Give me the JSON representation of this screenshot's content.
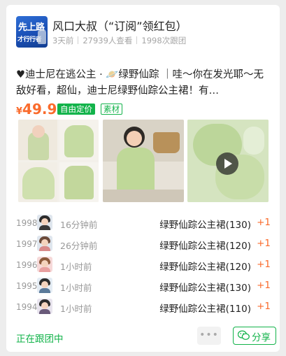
{
  "header": {
    "avatar_line1": "先上路",
    "avatar_line2": "才行行者",
    "name": "风口大叔（“订阅”领红包）",
    "time": "3天前",
    "views": "27939人查看",
    "followers": "1998次跟团"
  },
  "post": {
    "title": "♥迪士尼在逃公主 · 🪐绿野仙踪 ｜哇～你在发光耶～无敌好看，超仙，迪士尼绿野仙踪公主裙！有…",
    "price_currency": "¥",
    "price_value": "49.9",
    "tag_price": "自由定价",
    "tag_material": "素材",
    "has_video": true
  },
  "orders": [
    {
      "num": "1998",
      "time": "16分钟前",
      "product": "绿野仙踪公主裙(130)",
      "qty": "+1"
    },
    {
      "num": "1997",
      "time": "26分钟前",
      "product": "绿野仙踪公主裙(120)",
      "qty": "+1"
    },
    {
      "num": "1996",
      "time": "1小时前",
      "product": "绿野仙踪公主裙(120)",
      "qty": "+1"
    },
    {
      "num": "1995",
      "time": "1小时前",
      "product": "绿野仙踪公主裙(130)",
      "qty": "+1"
    },
    {
      "num": "1994",
      "time": "1小时前",
      "product": "绿野仙踪公主裙(110)",
      "qty": "+1"
    }
  ],
  "footer": {
    "status": "正在跟团中",
    "more": "•••",
    "share": "分享"
  },
  "colors": {
    "accent_green": "#12b34a",
    "price_orange": "#fa6b2c"
  }
}
